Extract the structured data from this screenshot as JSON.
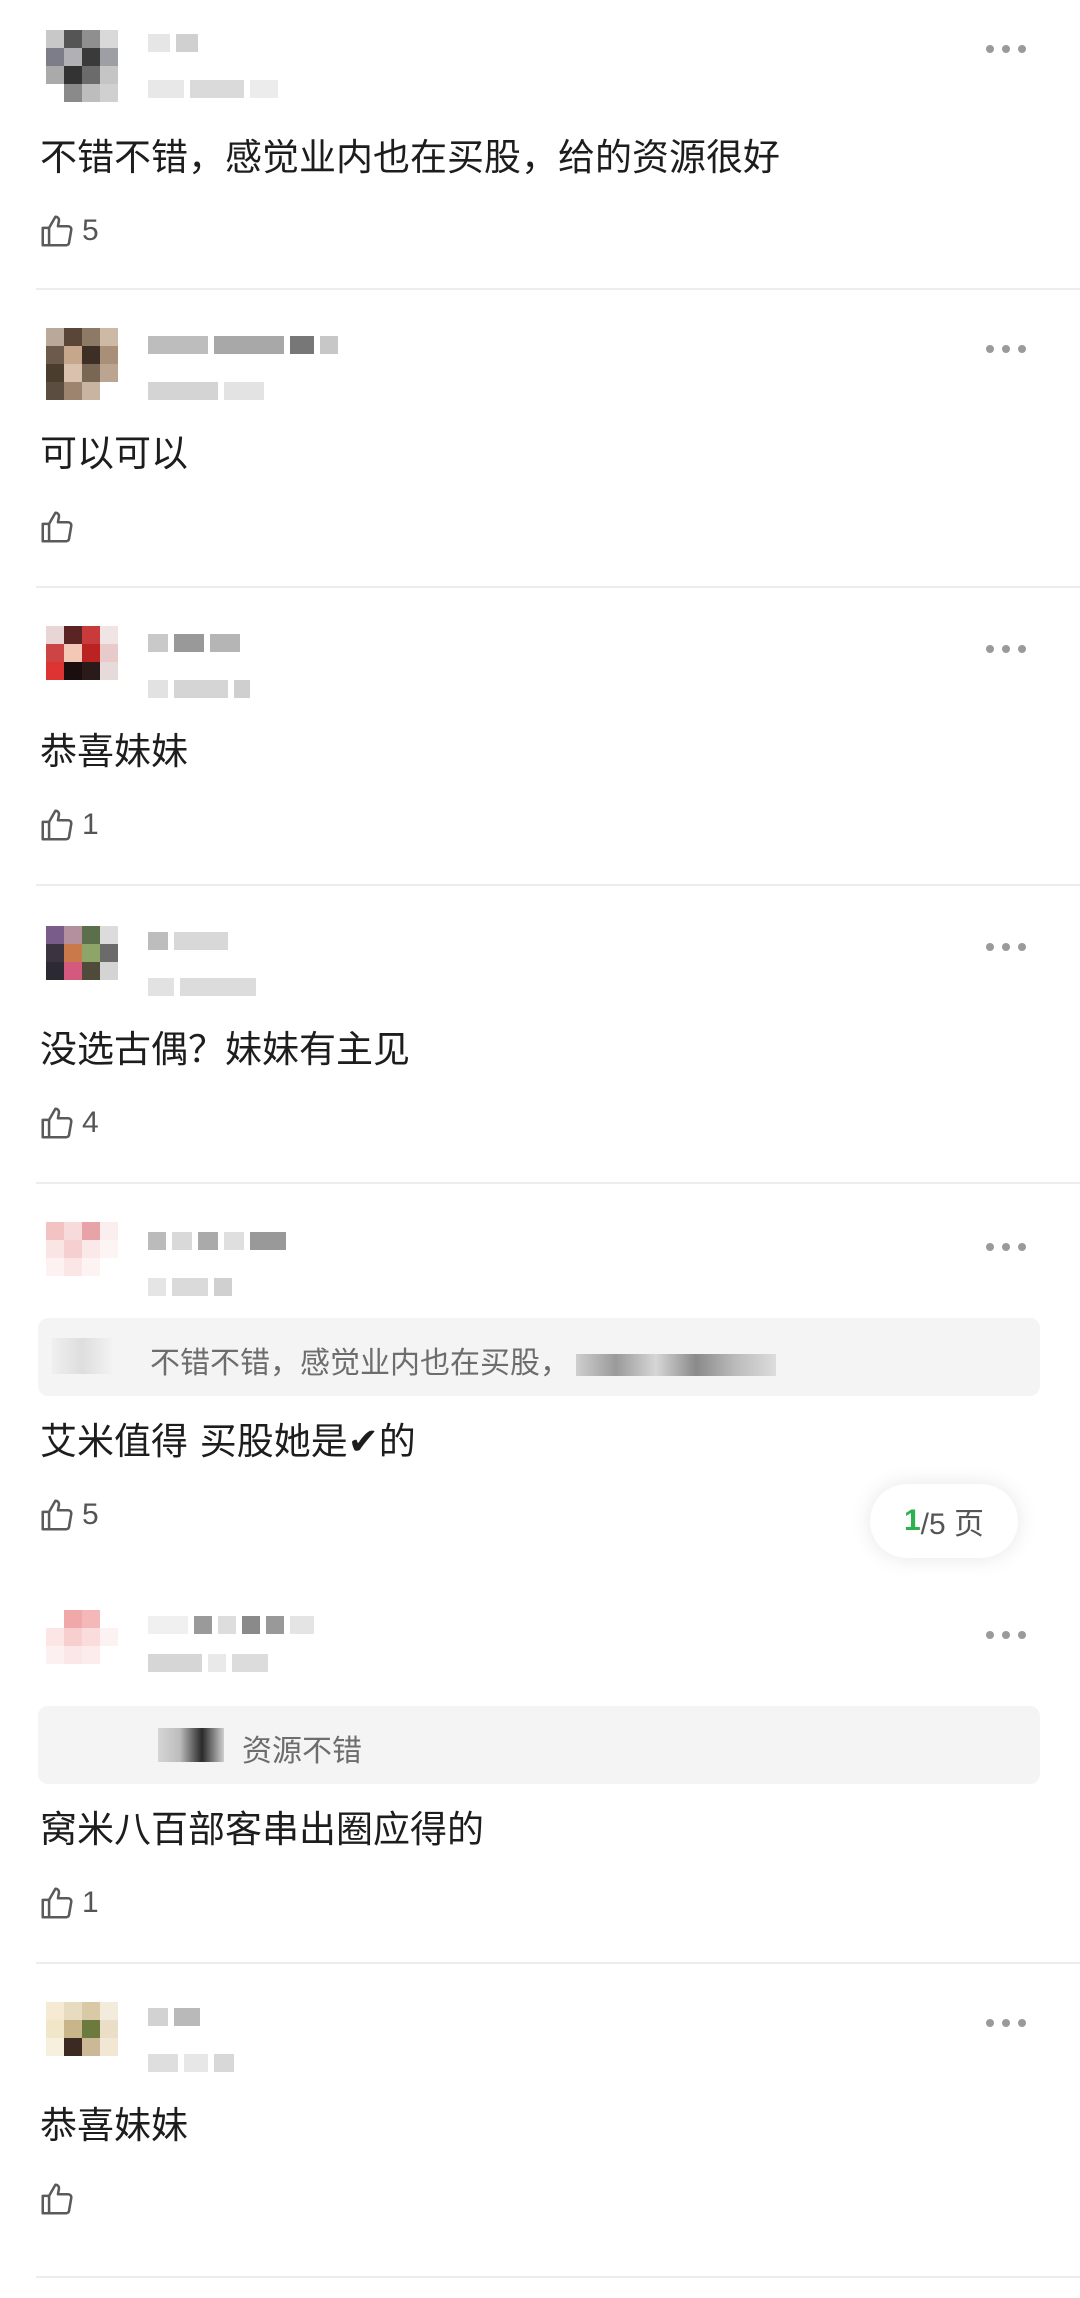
{
  "comments": [
    {
      "text": "不错不错，感觉业内也在买股，给的资源很好",
      "likes": "5"
    },
    {
      "text": "可以可以",
      "likes": ""
    },
    {
      "text": "恭喜妹妹",
      "likes": "1"
    },
    {
      "text": "没选古偶？妹妹有主见",
      "likes": "4"
    },
    {
      "text": "艾米值得 买股她是✔的",
      "likes": "5",
      "quote": "不错不错，感觉业内也在买股，"
    },
    {
      "text": "窝米八百部客串出圈应得的",
      "likes": "1",
      "quote": "资源不错"
    },
    {
      "text": "恭喜妹妹",
      "likes": ""
    }
  ],
  "pager": {
    "current": "1",
    "rest": "/5 页"
  },
  "colors": {
    "accent": "#2bb24c",
    "icon": "#5a5a5a"
  },
  "icons": {
    "like": "thumbs-up-icon",
    "more": "more-dots-icon"
  }
}
